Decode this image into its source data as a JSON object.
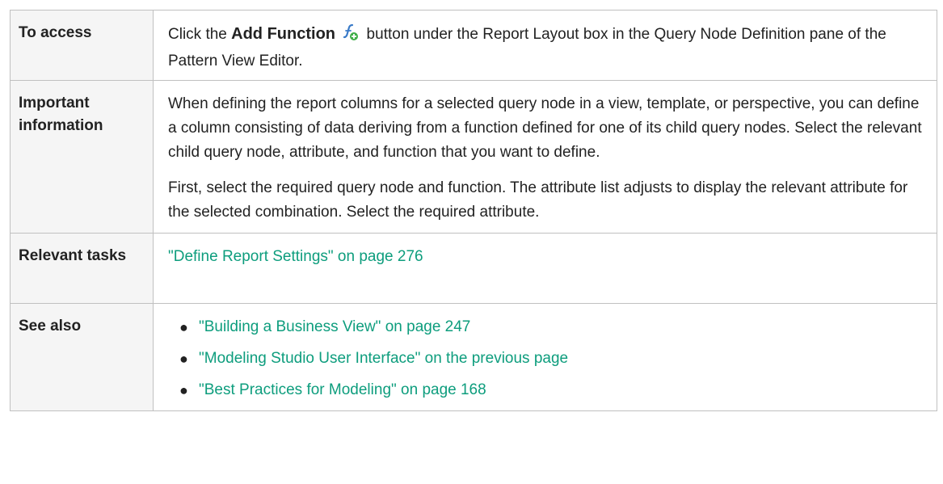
{
  "rows": {
    "access": {
      "label": "To access",
      "text_before": "Click the ",
      "button_label": "Add Function",
      "icon": "add-function-icon",
      "text_after": " button under the Report Layout box in the Query Node Definition pane of the Pattern View Editor."
    },
    "important": {
      "label": "Important information",
      "paragraph1": "When defining the report columns for a selected query node in a view, template, or perspective, you can define a column consisting of data deriving from a function defined for one of its child query nodes. Select the relevant child query node, attribute, and function that you want to define.",
      "paragraph2": "First, select the required query node and function. The attribute list adjusts to display the relevant attribute for the selected combination. Select the required attribute."
    },
    "tasks": {
      "label": "Relevant tasks",
      "link": "\"Define Report Settings\" on page 276"
    },
    "see_also": {
      "label": "See also",
      "links": [
        "\"Building a Business View\" on page 247",
        "\"Modeling Studio User Interface\" on the previous page",
        "\"Best Practices for Modeling\" on page 168"
      ]
    }
  },
  "colors": {
    "link": "#0d9d7d",
    "border": "#c0c0c0",
    "label_background": "#f5f5f5",
    "text": "#222222"
  }
}
